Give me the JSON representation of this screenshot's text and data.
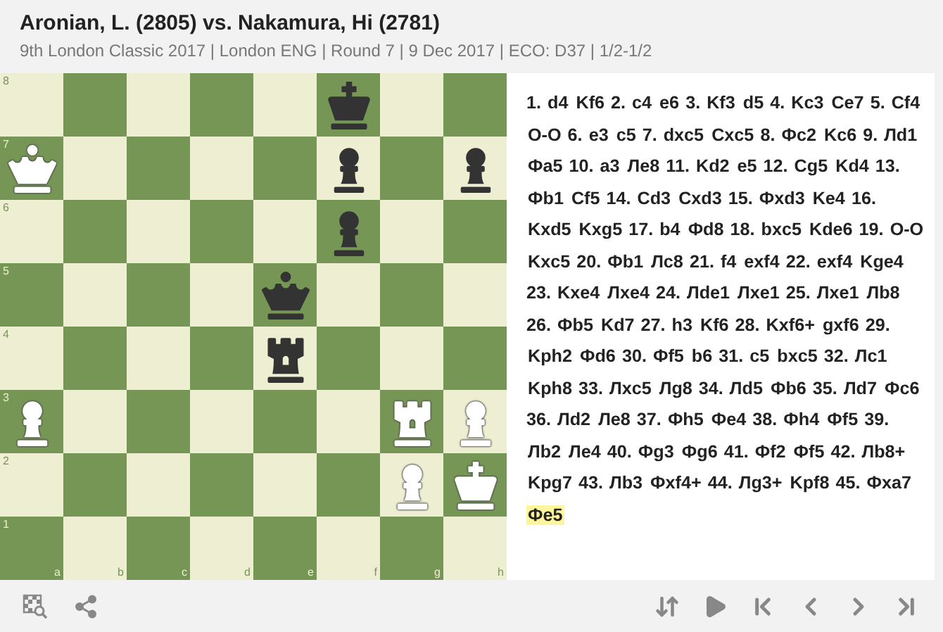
{
  "header": {
    "title": "Aronian, L. (2805) vs. Nakamura, Hi (2781)",
    "subtitle": "9th London Classic 2017 | London ENG | Round 7 | 9 Dec 2017 | ECO: D37 | 1/2-1/2"
  },
  "board": {
    "files": [
      "a",
      "b",
      "c",
      "d",
      "e",
      "f",
      "g",
      "h"
    ],
    "ranks": [
      {
        "label": "8",
        "squares": [
          {
            "kind": "empty"
          },
          {
            "kind": "empty"
          },
          {
            "kind": "empty"
          },
          {
            "kind": "empty"
          },
          {
            "kind": "empty"
          },
          {
            "kind": "king",
            "color": "#333333"
          },
          {
            "kind": "empty"
          },
          {
            "kind": "empty"
          }
        ]
      },
      {
        "label": "7",
        "squares": [
          {
            "kind": "queen",
            "color": "#ffffff"
          },
          {
            "kind": "empty"
          },
          {
            "kind": "empty"
          },
          {
            "kind": "empty"
          },
          {
            "kind": "empty"
          },
          {
            "kind": "pawn",
            "color": "#333333"
          },
          {
            "kind": "empty"
          },
          {
            "kind": "pawn",
            "color": "#333333"
          }
        ]
      },
      {
        "label": "6",
        "squares": [
          {
            "kind": "empty"
          },
          {
            "kind": "empty"
          },
          {
            "kind": "empty"
          },
          {
            "kind": "empty"
          },
          {
            "kind": "empty"
          },
          {
            "kind": "pawn",
            "color": "#333333"
          },
          {
            "kind": "empty"
          },
          {
            "kind": "empty"
          }
        ]
      },
      {
        "label": "5",
        "squares": [
          {
            "kind": "empty"
          },
          {
            "kind": "empty"
          },
          {
            "kind": "empty"
          },
          {
            "kind": "empty"
          },
          {
            "kind": "queen",
            "color": "#333333"
          },
          {
            "kind": "empty"
          },
          {
            "kind": "empty"
          },
          {
            "kind": "empty"
          }
        ]
      },
      {
        "label": "4",
        "squares": [
          {
            "kind": "empty"
          },
          {
            "kind": "empty"
          },
          {
            "kind": "empty"
          },
          {
            "kind": "empty"
          },
          {
            "kind": "rook",
            "color": "#333333"
          },
          {
            "kind": "empty"
          },
          {
            "kind": "empty"
          },
          {
            "kind": "empty"
          }
        ]
      },
      {
        "label": "3",
        "squares": [
          {
            "kind": "pawn",
            "color": "#ffffff"
          },
          {
            "kind": "empty"
          },
          {
            "kind": "empty"
          },
          {
            "kind": "empty"
          },
          {
            "kind": "empty"
          },
          {
            "kind": "empty"
          },
          {
            "kind": "rook",
            "color": "#ffffff"
          },
          {
            "kind": "pawn",
            "color": "#ffffff"
          }
        ]
      },
      {
        "label": "2",
        "squares": [
          {
            "kind": "empty"
          },
          {
            "kind": "empty"
          },
          {
            "kind": "empty"
          },
          {
            "kind": "empty"
          },
          {
            "kind": "empty"
          },
          {
            "kind": "empty"
          },
          {
            "kind": "pawn",
            "color": "#ffffff"
          },
          {
            "kind": "king",
            "color": "#ffffff"
          }
        ]
      },
      {
        "label": "1",
        "squares": [
          {
            "kind": "empty"
          },
          {
            "kind": "empty"
          },
          {
            "kind": "empty"
          },
          {
            "kind": "empty"
          },
          {
            "kind": "empty"
          },
          {
            "kind": "empty"
          },
          {
            "kind": "empty"
          },
          {
            "kind": "empty"
          }
        ]
      }
    ]
  },
  "moves": [
    {
      "number": "1.",
      "white": {
        "san": "d4",
        "selected": false
      },
      "black": {
        "san": "Kf6",
        "selected": false
      }
    },
    {
      "number": "2.",
      "white": {
        "san": "c4",
        "selected": false
      },
      "black": {
        "san": "e6",
        "selected": false
      }
    },
    {
      "number": "3.",
      "white": {
        "san": "Kf3",
        "selected": false
      },
      "black": {
        "san": "d5",
        "selected": false
      }
    },
    {
      "number": "4.",
      "white": {
        "san": "Kc3",
        "selected": false
      },
      "black": {
        "san": "Ce7",
        "selected": false
      }
    },
    {
      "number": "5.",
      "white": {
        "san": "Cf4",
        "selected": false
      },
      "black": {
        "san": "O-O",
        "selected": false
      }
    },
    {
      "number": "6.",
      "white": {
        "san": "e3",
        "selected": false
      },
      "black": {
        "san": "c5",
        "selected": false
      }
    },
    {
      "number": "7.",
      "white": {
        "san": "dxc5",
        "selected": false
      },
      "black": {
        "san": "Cxc5",
        "selected": false
      }
    },
    {
      "number": "8.",
      "white": {
        "san": "Фc2",
        "selected": false
      },
      "black": {
        "san": "Kc6",
        "selected": false
      }
    },
    {
      "number": "9.",
      "white": {
        "san": "Лd1",
        "selected": false
      },
      "black": {
        "san": "Фa5",
        "selected": false
      }
    },
    {
      "number": "10.",
      "white": {
        "san": "a3",
        "selected": false
      },
      "black": {
        "san": "Лe8",
        "selected": false
      }
    },
    {
      "number": "11.",
      "white": {
        "san": "Kd2",
        "selected": false
      },
      "black": {
        "san": "e5",
        "selected": false
      }
    },
    {
      "number": "12.",
      "white": {
        "san": "Cg5",
        "selected": false
      },
      "black": {
        "san": "Kd4",
        "selected": false
      }
    },
    {
      "number": "13.",
      "white": {
        "san": "Фb1",
        "selected": false
      },
      "black": {
        "san": "Cf5",
        "selected": false
      }
    },
    {
      "number": "14.",
      "white": {
        "san": "Cd3",
        "selected": false
      },
      "black": {
        "san": "Cxd3",
        "selected": false
      }
    },
    {
      "number": "15.",
      "white": {
        "san": "Фxd3",
        "selected": false
      },
      "black": {
        "san": "Ke4",
        "selected": false
      }
    },
    {
      "number": "16.",
      "white": {
        "san": "Kxd5",
        "selected": false
      },
      "black": {
        "san": "Kxg5",
        "selected": false
      }
    },
    {
      "number": "17.",
      "white": {
        "san": "b4",
        "selected": false
      },
      "black": {
        "san": "Фd8",
        "selected": false
      }
    },
    {
      "number": "18.",
      "white": {
        "san": "bxc5",
        "selected": false
      },
      "black": {
        "san": "Kde6",
        "selected": false
      }
    },
    {
      "number": "19.",
      "white": {
        "san": "O-O",
        "selected": false
      },
      "black": {
        "san": "Kxc5",
        "selected": false
      }
    },
    {
      "number": "20.",
      "white": {
        "san": "Фb1",
        "selected": false
      },
      "black": {
        "san": "Лc8",
        "selected": false
      }
    },
    {
      "number": "21.",
      "white": {
        "san": "f4",
        "selected": false
      },
      "black": {
        "san": "exf4",
        "selected": false
      }
    },
    {
      "number": "22.",
      "white": {
        "san": "exf4",
        "selected": false
      },
      "black": {
        "san": "Kge4",
        "selected": false
      }
    },
    {
      "number": "23.",
      "white": {
        "san": "Kxe4",
        "selected": false
      },
      "black": {
        "san": "Лxe4",
        "selected": false
      }
    },
    {
      "number": "24.",
      "white": {
        "san": "Лde1",
        "selected": false
      },
      "black": {
        "san": "Лxe1",
        "selected": false
      }
    },
    {
      "number": "25.",
      "white": {
        "san": "Лxe1",
        "selected": false
      },
      "black": {
        "san": "Лb8",
        "selected": false
      }
    },
    {
      "number": "26.",
      "white": {
        "san": "Фb5",
        "selected": false
      },
      "black": {
        "san": "Kd7",
        "selected": false
      }
    },
    {
      "number": "27.",
      "white": {
        "san": "h3",
        "selected": false
      },
      "black": {
        "san": "Kf6",
        "selected": false
      }
    },
    {
      "number": "28.",
      "white": {
        "san": "Kxf6+",
        "selected": false
      },
      "black": {
        "san": "gxf6",
        "selected": false
      }
    },
    {
      "number": "29.",
      "white": {
        "san": "Kph2",
        "selected": false
      },
      "black": {
        "san": "Фd6",
        "selected": false
      }
    },
    {
      "number": "30.",
      "white": {
        "san": "Фf5",
        "selected": false
      },
      "black": {
        "san": "b6",
        "selected": false
      }
    },
    {
      "number": "31.",
      "white": {
        "san": "c5",
        "selected": false
      },
      "black": {
        "san": "bxc5",
        "selected": false
      }
    },
    {
      "number": "32.",
      "white": {
        "san": "Лc1",
        "selected": false
      },
      "black": {
        "san": "Kph8",
        "selected": false
      }
    },
    {
      "number": "33.",
      "white": {
        "san": "Лxc5",
        "selected": false
      },
      "black": {
        "san": "Лg8",
        "selected": false
      }
    },
    {
      "number": "34.",
      "white": {
        "san": "Лd5",
        "selected": false
      },
      "black": {
        "san": "Фb6",
        "selected": false
      }
    },
    {
      "number": "35.",
      "white": {
        "san": "Лd7",
        "selected": false
      },
      "black": {
        "san": "Фc6",
        "selected": false
      }
    },
    {
      "number": "36.",
      "white": {
        "san": "Лd2",
        "selected": false
      },
      "black": {
        "san": "Лe8",
        "selected": false
      }
    },
    {
      "number": "37.",
      "white": {
        "san": "Фh5",
        "selected": false
      },
      "black": {
        "san": "Фe4",
        "selected": false
      }
    },
    {
      "number": "38.",
      "white": {
        "san": "Фh4",
        "selected": false
      },
      "black": {
        "san": "Фf5",
        "selected": false
      }
    },
    {
      "number": "39.",
      "white": {
        "san": "Лb2",
        "selected": false
      },
      "black": {
        "san": "Лe4",
        "selected": false
      }
    },
    {
      "number": "40.",
      "white": {
        "san": "Фg3",
        "selected": false
      },
      "black": {
        "san": "Фg6",
        "selected": false
      }
    },
    {
      "number": "41.",
      "white": {
        "san": "Фf2",
        "selected": false
      },
      "black": {
        "san": "Фf5",
        "selected": false
      }
    },
    {
      "number": "42.",
      "white": {
        "san": "Лb8+",
        "selected": false
      },
      "black": {
        "san": "Kpg7",
        "selected": false
      }
    },
    {
      "number": "43.",
      "white": {
        "san": "Лb3",
        "selected": false
      },
      "black": {
        "san": "Фxf4+",
        "selected": false
      }
    },
    {
      "number": "44.",
      "white": {
        "san": "Лg3+",
        "selected": false
      },
      "black": {
        "san": "Kpf8",
        "selected": false
      }
    },
    {
      "number": "45.",
      "white": {
        "san": "Фxa7",
        "selected": false
      },
      "black": {
        "san": "Фe5",
        "selected": true
      }
    }
  ]
}
